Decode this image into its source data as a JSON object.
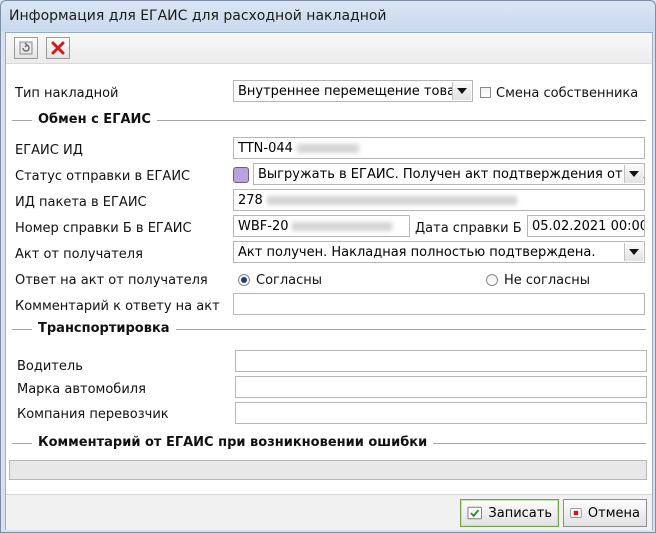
{
  "window": {
    "title": "Информация для ЕГАИС для расходной накладной"
  },
  "toolbar": {
    "refresh_icon": "refresh-icon",
    "delete_icon": "delete-icon"
  },
  "invoice_type": {
    "label": "Тип накладной",
    "value": "Внутреннее перемещение товаров",
    "owner_change_label": "Смена собственника",
    "owner_change_checked": false
  },
  "egais_section": {
    "title": "Обмен с ЕГАИС"
  },
  "egais_id": {
    "label": "ЕГАИС ИД",
    "value": "TTN-044"
  },
  "send_status": {
    "label": "Статус отправки в ЕГАИС",
    "value": "Выгружать в ЕГАИС. Получен акт подтверждения от полу",
    "color": "#b7a3dd"
  },
  "package_id": {
    "label": "ИД пакета в ЕГАИС",
    "value": "278"
  },
  "cert_b": {
    "label": "Номер справки Б в ЕГАИС",
    "value": "WBF-20",
    "date_label": "Дата справки Б",
    "date_value": "05.02.2021 00:00"
  },
  "receiver_act": {
    "label": "Акт от получателя",
    "value": "Акт получен. Накладная полностью подтверждена."
  },
  "act_answer": {
    "label": "Ответ на акт от получателя",
    "option_agree": "Согласны",
    "option_disagree": "Не согласны",
    "selected": "Согласны"
  },
  "answer_comment": {
    "label": "Комментарий к ответу на акт",
    "value": ""
  },
  "transport_section": {
    "title": "Транспортировка"
  },
  "transport": {
    "driver_label": "Водитель",
    "driver_value": "",
    "car_label": "Марка автомобиля",
    "car_value": "",
    "carrier_label": "Компания перевозчик",
    "carrier_value": ""
  },
  "error_section": {
    "title": "Комментарий от ЕГАИС при возникновении ошибки",
    "value": ""
  },
  "footer": {
    "save_label": "Записать",
    "cancel_label": "Отмена"
  }
}
